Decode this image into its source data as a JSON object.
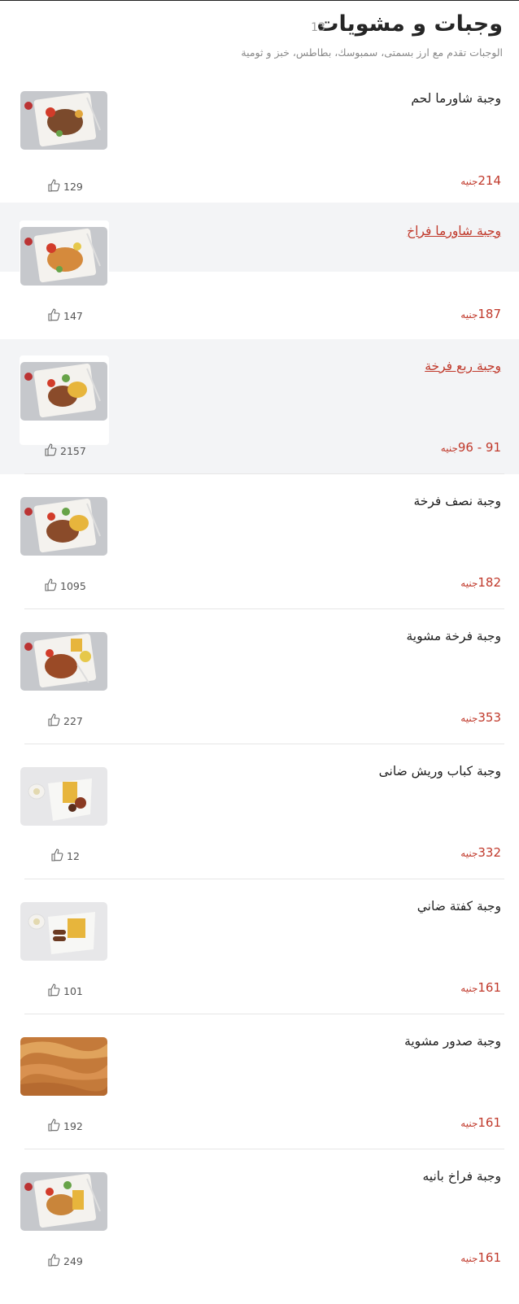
{
  "header": {
    "title": "وجبات و مشويات",
    "count": "13",
    "subtitle": "الوجبات تقدم مع ارز بسمتى، سمبوسك، بطاطس، خبز و ثومية"
  },
  "items": [
    {
      "name": "وجبة شاورما لحم",
      "price": "214",
      "currency": "جنيه",
      "likes": "129"
    },
    {
      "name": "وجبة شاورما فراخ",
      "price": "187",
      "currency": "جنيه",
      "likes": "147"
    },
    {
      "name": "وجبة ربع فرخة",
      "price": "91 - 96",
      "currency": "جنيه",
      "likes": "2157"
    },
    {
      "name": "وجبة نصف فرخة",
      "price": "182",
      "currency": "جنيه",
      "likes": "1095"
    },
    {
      "name": "وجبة فرخة مشوية",
      "price": "353",
      "currency": "جنيه",
      "likes": "227"
    },
    {
      "name": "وجبة كباب وريش ضانى",
      "price": "332",
      "currency": "جنيه",
      "likes": "12"
    },
    {
      "name": "وجبة كفتة ضاني",
      "price": "161",
      "currency": "جنيه",
      "likes": "101"
    },
    {
      "name": "وجبة صدور مشوية",
      "price": "161",
      "currency": "جنيه",
      "likes": "192"
    },
    {
      "name": "وجبة فراخ بانيه",
      "price": "161",
      "currency": "جنيه",
      "likes": "249"
    }
  ],
  "colors": {
    "price": "#c0392b",
    "highlight_bg": "#f3f4f6"
  },
  "icons": {
    "like": "thumbs-up-icon"
  }
}
